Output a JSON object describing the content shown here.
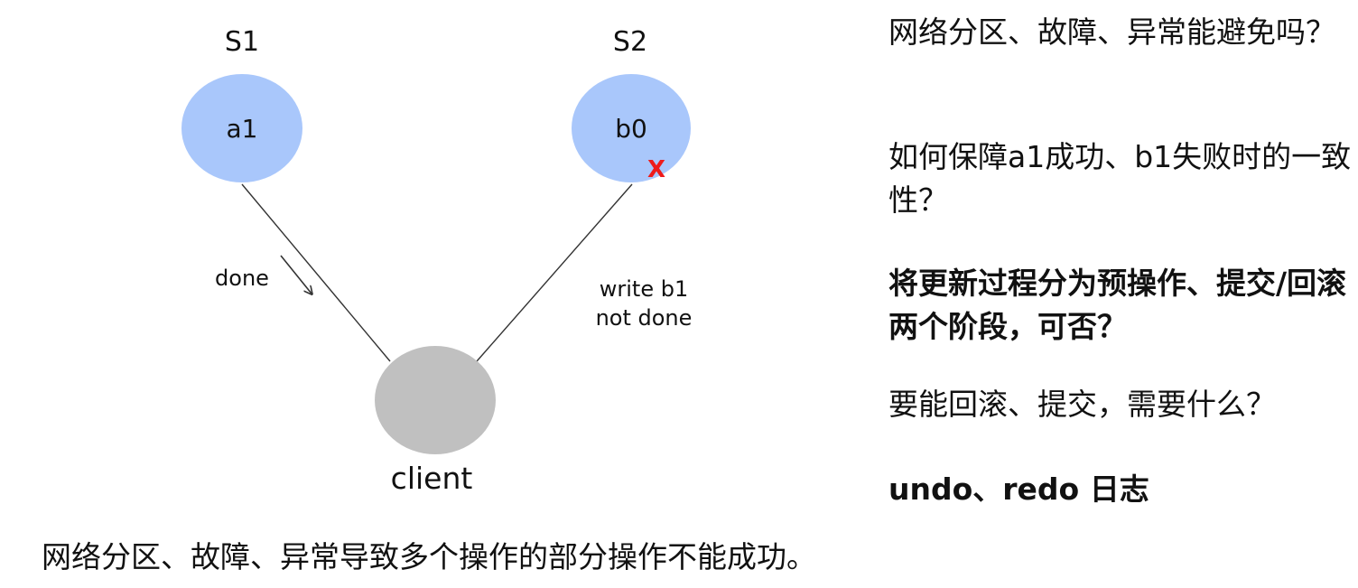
{
  "diagram": {
    "server1": {
      "label": "S1",
      "value": "a1"
    },
    "server2": {
      "label": "S2",
      "value": "b0",
      "fail_mark": "X"
    },
    "client": {
      "label": "client"
    },
    "edge_s1": {
      "label": "done"
    },
    "edge_s2": {
      "label_line1": "write b1",
      "label_line2": "not done"
    },
    "colors": {
      "server_fill": "#a9c7fb",
      "client_fill": "#c0c0c0",
      "fail_mark": "#ee1b1b",
      "line": "#333333"
    }
  },
  "notes": [
    {
      "text": "网络分区、故障、异常能避免吗？",
      "bold": false
    },
    {
      "text": "如何保障a1成功、b1失败时的一致性？",
      "bold": false
    },
    {
      "text": "将更新过程分为预操作、提交/回滚两个阶段，可否？",
      "bold": true
    },
    {
      "text": "要能回滚、提交，需要什么？",
      "bold": false
    },
    {
      "text": "undo、redo 日志",
      "bold": true
    }
  ],
  "caption": "网络分区、故障、异常导致多个操作的部分操作不能成功。"
}
